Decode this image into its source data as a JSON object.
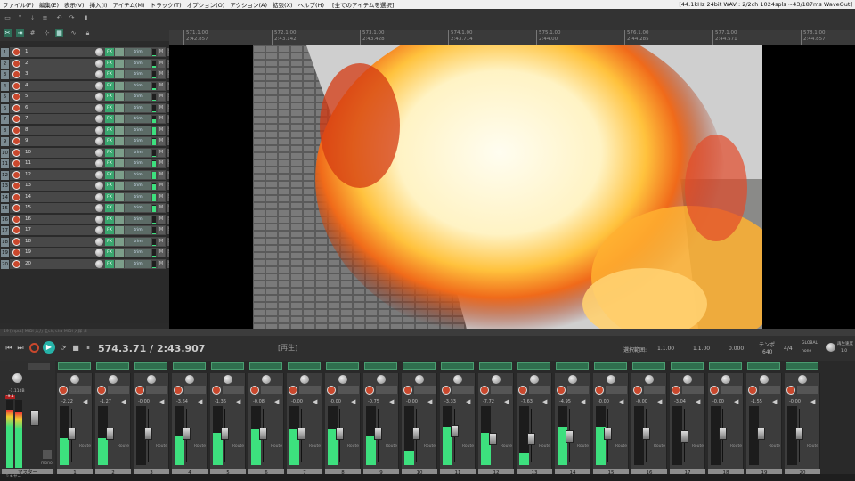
{
  "menu": {
    "items": [
      "ファイル(F)",
      "編集(E)",
      "表示(V)",
      "挿入(I)",
      "アイテム(M)",
      "トラック(T)",
      "オプション(O)",
      "アクション(A)",
      "拡張(X)",
      "ヘルプ(H)"
    ],
    "selection_label": "[全てのアイテムを選択]",
    "audio_status": "[44.1kHz 24bit WAV : 2/2ch 1024spls ~43/187ms WaveOut]"
  },
  "ruler": {
    "marks": [
      {
        "bar": "571.1.00",
        "time": "2:42.857"
      },
      {
        "bar": "572.1.00",
        "time": "2:43.142"
      },
      {
        "bar": "573.1.00",
        "time": "2:43.428"
      },
      {
        "bar": "574.1.00",
        "time": "2:43.714"
      },
      {
        "bar": "575.1.00",
        "time": "2:44.00"
      },
      {
        "bar": "576.1.00",
        "time": "2:44.285"
      },
      {
        "bar": "577.1.00",
        "time": "2:44.571"
      },
      {
        "bar": "578.1.00",
        "time": "2:44.857"
      }
    ]
  },
  "tracks": [
    {
      "num": "1",
      "name": "1",
      "level": 0.1
    },
    {
      "num": "2",
      "name": "2",
      "level": 0.15
    },
    {
      "num": "3",
      "name": "3",
      "level": 0.1
    },
    {
      "num": "4",
      "name": "4",
      "level": 0.2
    },
    {
      "num": "5",
      "name": "5",
      "level": 0.1
    },
    {
      "num": "6",
      "name": "6",
      "level": 0.1
    },
    {
      "num": "7",
      "name": "7",
      "level": 0.5
    },
    {
      "num": "8",
      "name": "8",
      "level": 0.9
    },
    {
      "num": "9",
      "name": "9",
      "level": 0.85
    },
    {
      "num": "10",
      "name": "10",
      "level": 0.1
    },
    {
      "num": "11",
      "name": "11",
      "level": 0.9
    },
    {
      "num": "12",
      "name": "12",
      "level": 0.9
    },
    {
      "num": "13",
      "name": "13",
      "level": 0.7
    },
    {
      "num": "14",
      "name": "14",
      "level": 0.9
    },
    {
      "num": "15",
      "name": "15",
      "level": 0.9
    },
    {
      "num": "16",
      "name": "16",
      "level": 0.1
    },
    {
      "num": "17",
      "name": "17",
      "level": 0.1
    },
    {
      "num": "18",
      "name": "18",
      "level": 0.1
    },
    {
      "num": "19",
      "name": "19",
      "level": 0.1
    },
    {
      "num": "20",
      "name": "20",
      "level": 0.1
    }
  ],
  "track_buttons": {
    "fx": "FX",
    "io": "trim",
    "mute": "M",
    "solo": "S"
  },
  "splitter_label": "19 [Input] MIDI 入力 全ch, cha MIDI 入録 ま",
  "transport": {
    "time": "574.3.71 / 2:43.907",
    "status": "[再生]",
    "sel_label": "選択範囲:",
    "sel_start": "1.1.00",
    "sel_end": "1.1.00",
    "sel_len": "0.000",
    "tempo_label": "テンポ",
    "tempo": "640",
    "timesig": "4/4",
    "global": "GLOBAL",
    "global_mode": "none",
    "rate_label": "再生速度",
    "rate": "1.0"
  },
  "mixer": {
    "master_label": "マスター",
    "master_vol": "-1.11dB",
    "master_peak": "-9.1",
    "mono": "mono",
    "route": "Route",
    "strips": [
      {
        "num": "1",
        "val": "-2.22",
        "level": 0.45,
        "fader": 0.35
      },
      {
        "num": "2",
        "val": "-1.27",
        "level": 0.45,
        "fader": 0.35
      },
      {
        "num": "3",
        "val": "-0.00",
        "level": 0.0,
        "fader": 0.35
      },
      {
        "num": "4",
        "val": "-3.64",
        "level": 0.5,
        "fader": 0.35
      },
      {
        "num": "5",
        "val": "-1.36",
        "level": 0.55,
        "fader": 0.35
      },
      {
        "num": "6",
        "val": "-0.08",
        "level": 0.6,
        "fader": 0.35
      },
      {
        "num": "7",
        "val": "-0.00",
        "level": 0.6,
        "fader": 0.35
      },
      {
        "num": "8",
        "val": "-0.00",
        "level": 0.6,
        "fader": 0.35
      },
      {
        "num": "9",
        "val": "-0.75",
        "level": 0.5,
        "fader": 0.35
      },
      {
        "num": "10",
        "val": "-0.00",
        "level": 0.25,
        "fader": 0.35
      },
      {
        "num": "11",
        "val": "-3.33",
        "level": 0.65,
        "fader": 0.3
      },
      {
        "num": "12",
        "val": "-7.72",
        "level": 0.55,
        "fader": 0.45
      },
      {
        "num": "13",
        "val": "-7.63",
        "level": 0.2,
        "fader": 0.45
      },
      {
        "num": "14",
        "val": "-4.95",
        "level": 0.65,
        "fader": 0.4
      },
      {
        "num": "15",
        "val": "-0.00",
        "level": 0.65,
        "fader": 0.35
      },
      {
        "num": "16",
        "val": "-0.00",
        "level": 0.0,
        "fader": 0.35
      },
      {
        "num": "17",
        "val": "-3.04",
        "level": 0.0,
        "fader": 0.4
      },
      {
        "num": "18",
        "val": "-0.00",
        "level": 0.0,
        "fader": 0.35
      },
      {
        "num": "19",
        "val": "-1.55",
        "level": 0.0,
        "fader": 0.35
      },
      {
        "num": "20",
        "val": "-0.00",
        "level": 0.0,
        "fader": 0.35
      }
    ]
  },
  "bottom_tab": "ミキサー",
  "colors": {
    "accent": "#26b3a8",
    "meter": "#3de07e",
    "record": "#c9482d"
  }
}
